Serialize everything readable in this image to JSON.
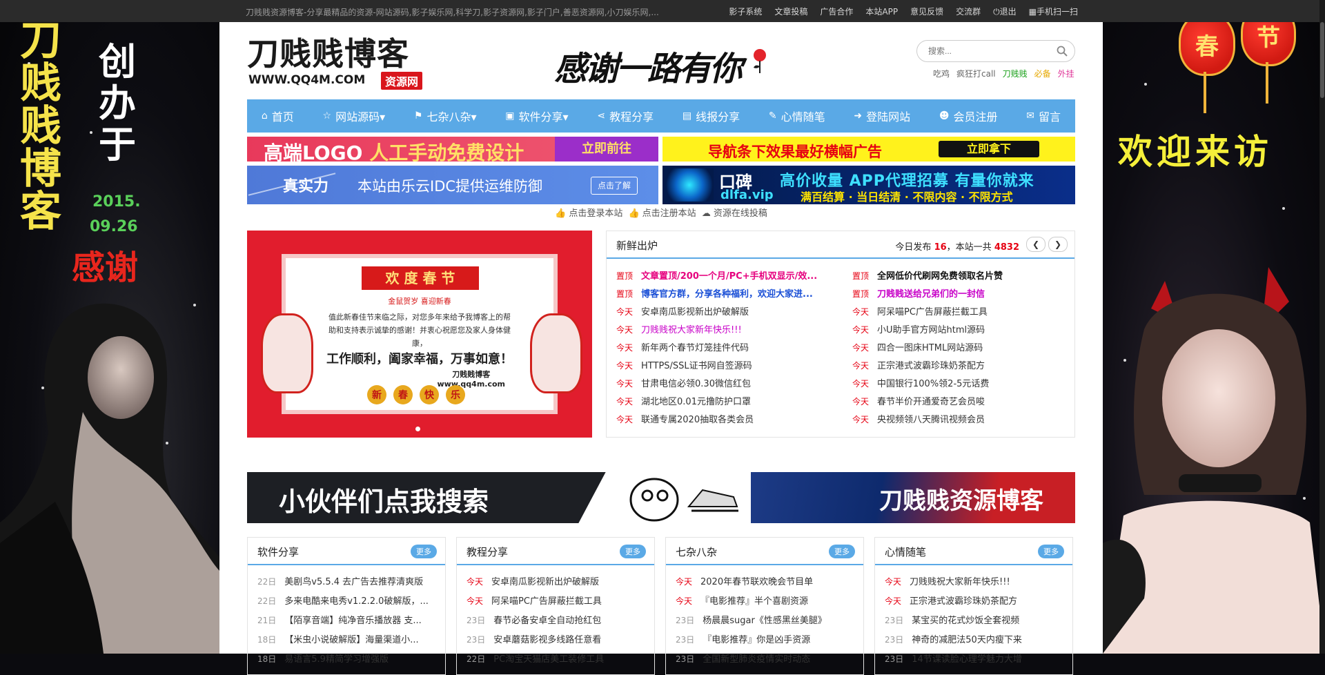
{
  "topbar": {
    "tagline": "刀贱贱资源博客-分享最精品的资源-网站源码,影子娱乐网,科学刀,影子资源网,影子门户,善恶资源网,小刀娱乐网,...",
    "links": [
      "影子系统",
      "文章投稿",
      "广告合作",
      "本站APP",
      "意见反馈",
      "交流群",
      "退出",
      "手机扫一扫"
    ]
  },
  "left_deco": {
    "vertical_title": [
      "刀",
      "贱",
      "贱",
      "博",
      "客"
    ],
    "founded_label": [
      "创",
      "办",
      "于"
    ],
    "date_line1": "2015.",
    "date_line2": "09.26",
    "thanks": "感谢"
  },
  "right_deco": {
    "lantern1": "春",
    "lantern2": "节",
    "welcome": "欢迎来访"
  },
  "header": {
    "logo_main": "刀贱贱博客",
    "logo_url": "WWW.QQ4M.COM",
    "logo_badge": "资源网",
    "slogan": "感谢一路有你",
    "search_placeholder": "搜索...",
    "hotwords": [
      {
        "label": "吃鸡",
        "color": "#666666"
      },
      {
        "label": "疯狂打call",
        "color": "#666666"
      },
      {
        "label": "刀贱贱",
        "color": "#1aa01a"
      },
      {
        "label": "必备",
        "color": "#e6a800"
      },
      {
        "label": "外挂",
        "color": "#e0399a"
      }
    ]
  },
  "nav": [
    {
      "icon": "⌂",
      "label": "首页"
    },
    {
      "icon": "☆",
      "label": "网站源码▾"
    },
    {
      "icon": "⚑",
      "label": "七杂八杂▾"
    },
    {
      "icon": "▣",
      "label": "软件分享▾"
    },
    {
      "icon": "⋖",
      "label": "教程分享"
    },
    {
      "icon": "▤",
      "label": "线报分享"
    },
    {
      "icon": "✎",
      "label": "心情随笔"
    },
    {
      "icon": "➜",
      "label": "登陆网站"
    },
    {
      "icon": "☻",
      "label": "会员注册"
    },
    {
      "icon": "✉",
      "label": "留言"
    }
  ],
  "ads": {
    "ad1_text_a": "高端LOGO",
    "ad1_text_b": "人工手动免费设计",
    "ad1_btn": "立即前往",
    "ad2_text": "导航条下效果最好横幅广告",
    "ad2_btn": "立即拿下",
    "ad3_left": "真实力",
    "ad3_mid": "本站由乐云IDC提供运维防御",
    "ad3_btn": "点击了解",
    "ad4_k": "口碑",
    "ad4_d": "dlfa.vip",
    "ad4_r1": "高价收量 APP代理招募 有量你就来",
    "ad4_r2": "满百结算 · 当日结清 · 不限内容 · 不限方式"
  },
  "sublinks": [
    "点击登录本站",
    "点击注册本站",
    "资源在线投稿"
  ],
  "slider": {
    "banner": "欢 度 春 节",
    "sub": "金鼠贺岁 喜迎新春",
    "msg": "值此新春佳节来临之际，对您多年来给予我博客上的帮助和支持表示诚挚的感谢！并衷心祝愿您及家人身体健康，",
    "bless": "工作顺利，阖家幸福，万事如意！",
    "sig": "刀贱贱博客",
    "sig_url": "www.qq4m.com",
    "chars": [
      "新",
      "春",
      "快",
      "乐"
    ]
  },
  "fresh": {
    "title": "新鲜出炉",
    "stat_prefix": "今日发布",
    "today_count": "16",
    "stat_mid": "，本站一共",
    "total_count": "4832",
    "left": [
      {
        "tag": "置顶",
        "text": "文章置顶/200一个月/PC+手机双显示/效...",
        "color": "#e6007e",
        "bold": true
      },
      {
        "tag": "置顶",
        "text": "博客官方群，分享各种福利，欢迎大家进...",
        "color": "#1a4fd6",
        "bold": true
      },
      {
        "tag": "今天",
        "text": "安卓南瓜影视新出炉破解版",
        "color": "#333333",
        "bold": false
      },
      {
        "tag": "今天",
        "text": "刀贱贱祝大家新年快乐!!!",
        "color": "#c800c8",
        "bold": false
      },
      {
        "tag": "今天",
        "text": "新年两个春节灯笼挂件代码",
        "color": "#333333",
        "bold": false
      },
      {
        "tag": "今天",
        "text": "HTTPS/SSL证书网自签源码",
        "color": "#333333",
        "bold": false
      },
      {
        "tag": "今天",
        "text": "甘肃电信必领0.30微信红包",
        "color": "#333333",
        "bold": false
      },
      {
        "tag": "今天",
        "text": "湖北地区0.01元撸防护口罩",
        "color": "#333333",
        "bold": false
      },
      {
        "tag": "今天",
        "text": "联通专属2020抽取各类会员",
        "color": "#333333",
        "bold": false
      }
    ],
    "right": [
      {
        "tag": "置顶",
        "text": "全网低价代刷网免费领取名片赞",
        "color": "#111111",
        "bold": true
      },
      {
        "tag": "置顶",
        "text": "刀贱贱送给兄弟们的一封信",
        "color": "#c800c8",
        "bold": true
      },
      {
        "tag": "今天",
        "text": "阿呆喵PC广告屏蔽拦截工具",
        "color": "#333333",
        "bold": false
      },
      {
        "tag": "今天",
        "text": "小U助手官方网站html源码",
        "color": "#333333",
        "bold": false
      },
      {
        "tag": "今天",
        "text": "四合一图床HTML网站源码",
        "color": "#333333",
        "bold": false
      },
      {
        "tag": "今天",
        "text": "正宗港式波霸珍珠奶茶配方",
        "color": "#333333",
        "bold": false
      },
      {
        "tag": "今天",
        "text": "中国银行100%领2-5元话费",
        "color": "#333333",
        "bold": false
      },
      {
        "tag": "今天",
        "text": "春节半价开通爱奇艺会员唆",
        "color": "#333333",
        "bold": false
      },
      {
        "tag": "今天",
        "text": "央视频领八天腾讯视频会员",
        "color": "#333333",
        "bold": false
      }
    ]
  },
  "wide_banner": {
    "left": "小伙伴们点我搜索",
    "right": "刀贱贱资源博客"
  },
  "panels": [
    {
      "title": "软件分享",
      "more": "更多",
      "rows": [
        {
          "d": "22日",
          "today": false,
          "text": "美剧鸟v5.5.4 去广告去推荐清爽版"
        },
        {
          "d": "22日",
          "today": false,
          "text": "多来电酷来电秀v1.2.2.0破解版，..."
        },
        {
          "d": "21日",
          "today": false,
          "text": "【陌享音端】纯净音乐播放器 支..."
        },
        {
          "d": "18日",
          "today": false,
          "text": "【米虫小说破解版】海量渠道小..."
        },
        {
          "d": "18日",
          "today": false,
          "text": "易语言5.9精简学习增强版"
        }
      ]
    },
    {
      "title": "教程分享",
      "more": "更多",
      "rows": [
        {
          "d": "今天",
          "today": true,
          "text": "安卓南瓜影视新出炉破解版"
        },
        {
          "d": "今天",
          "today": true,
          "text": "阿呆喵PC广告屏蔽拦截工具"
        },
        {
          "d": "23日",
          "today": false,
          "text": "春节必备安卓全自动抢红包"
        },
        {
          "d": "23日",
          "today": false,
          "text": "安卓蘑菇影视多线路任意看"
        },
        {
          "d": "22日",
          "today": false,
          "text": "PC淘宝天猫店美工装修工具"
        }
      ]
    },
    {
      "title": "七杂八杂",
      "more": "更多",
      "rows": [
        {
          "d": "今天",
          "today": true,
          "text": "2020年春节联欢晚会节目单"
        },
        {
          "d": "今天",
          "today": true,
          "text": "『电影推荐』半个喜剧资源"
        },
        {
          "d": "23日",
          "today": false,
          "text": "杨晨晨sugar《性感黑丝美腿》"
        },
        {
          "d": "23日",
          "today": false,
          "text": "『电影推荐』你是凶手资源"
        },
        {
          "d": "23日",
          "today": false,
          "text": "全国新型肺炎疫情实时动态"
        }
      ]
    },
    {
      "title": "心情随笔",
      "more": "更多",
      "rows": [
        {
          "d": "今天",
          "today": true,
          "text": "刀贱贱祝大家新年快乐!!!"
        },
        {
          "d": "今天",
          "today": true,
          "text": "正宗港式波霸珍珠奶茶配方"
        },
        {
          "d": "23日",
          "today": false,
          "text": "某宝买的花式炒饭全套视频"
        },
        {
          "d": "23日",
          "today": false,
          "text": "神奇的减肥法50天内瘦下来"
        },
        {
          "d": "23日",
          "today": false,
          "text": "14节课读脸心理学魅力大增"
        }
      ]
    }
  ]
}
